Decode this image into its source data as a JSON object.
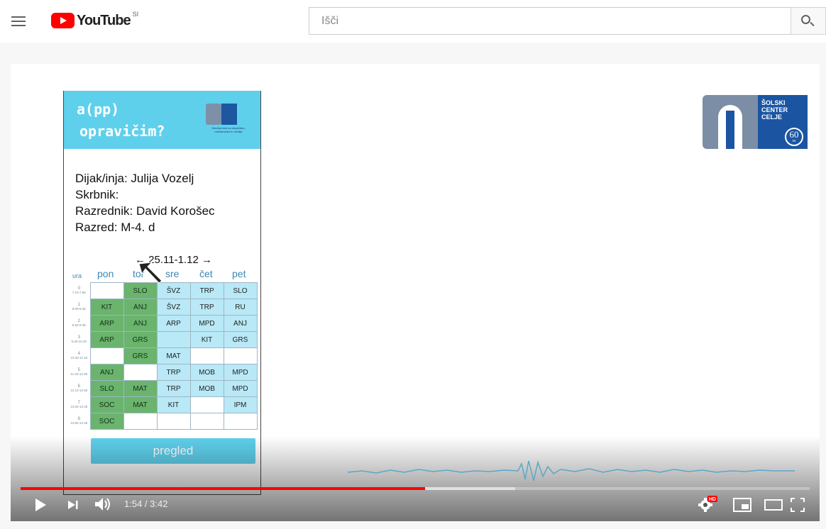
{
  "header": {
    "logo_text": "YouTube",
    "country_code": "SI",
    "search_placeholder": "Išči"
  },
  "video": {
    "app_title_line1": "a(pp)",
    "app_title_line2": "opravičim?",
    "mini_logo_caption": "Srednja šola za strojništvo, mehatroniko in medije",
    "student_label": "Dijak/inja: Julija Vozelj",
    "guardian_label": "Skrbnik:",
    "teacher_label": "Razrednik: David Korošec",
    "class_label": "Razred: M-4. d",
    "week_nav": "← 25.11-1.12 →",
    "days": [
      "ura",
      "pon",
      "tor",
      "sre",
      "čet",
      "pet"
    ],
    "timetable": [
      {
        "num": "0",
        "time": "7.10-7.55",
        "cells": [
          [
            "",
            "w"
          ],
          [
            "SLO",
            "g"
          ],
          [
            "ŠVZ",
            "b"
          ],
          [
            "TRP",
            "b"
          ],
          [
            "SLO",
            "b"
          ]
        ]
      },
      {
        "num": "1",
        "time": "8.00-8.45",
        "cells": [
          [
            "KIT",
            "g"
          ],
          [
            "ANJ",
            "g"
          ],
          [
            "ŠVZ",
            "b"
          ],
          [
            "TRP",
            "b"
          ],
          [
            "RU",
            "b"
          ]
        ]
      },
      {
        "num": "2",
        "time": "8.50-9.35",
        "cells": [
          [
            "ARP",
            "g"
          ],
          [
            "ANJ",
            "g"
          ],
          [
            "ARP",
            "b"
          ],
          [
            "MPD",
            "b"
          ],
          [
            "ANJ",
            "b"
          ]
        ]
      },
      {
        "num": "3",
        "time": "9.40-10.25",
        "cells": [
          [
            "ARP",
            "g"
          ],
          [
            "GRS",
            "g"
          ],
          [
            "",
            "b"
          ],
          [
            "KIT",
            "b"
          ],
          [
            "GRS",
            "b"
          ]
        ]
      },
      {
        "num": "4",
        "time": "10.30-11.15",
        "cells": [
          [
            "",
            "w"
          ],
          [
            "GRS",
            "g"
          ],
          [
            "MAT",
            "b"
          ],
          [
            "",
            "w"
          ],
          [
            "",
            "w"
          ]
        ]
      },
      {
        "num": "5",
        "time": "11.20-12.05",
        "cells": [
          [
            "ANJ",
            "g"
          ],
          [
            "",
            "w"
          ],
          [
            "TRP",
            "b"
          ],
          [
            "MOB",
            "b"
          ],
          [
            "MPD",
            "b"
          ]
        ]
      },
      {
        "num": "6",
        "time": "12.10-12.55",
        "cells": [
          [
            "SLO",
            "g"
          ],
          [
            "MAT",
            "g"
          ],
          [
            "TRP",
            "b"
          ],
          [
            "MOB",
            "b"
          ],
          [
            "MPD",
            "b"
          ]
        ]
      },
      {
        "num": "7",
        "time": "13.00-13.45",
        "cells": [
          [
            "SOC",
            "g"
          ],
          [
            "MAT",
            "g"
          ],
          [
            "KIT",
            "b"
          ],
          [
            "",
            "w"
          ],
          [
            "IPM",
            "b"
          ]
        ]
      },
      {
        "num": "8",
        "time": "13.50-14.35",
        "cells": [
          [
            "SOC",
            "g"
          ],
          [
            "",
            "w"
          ],
          [
            "",
            "w"
          ],
          [
            "",
            "w"
          ],
          [
            "",
            "w"
          ]
        ]
      }
    ],
    "button_label": "pregled",
    "school_logo_text": [
      "ŠOLSKI",
      "CENTER",
      "CELJE"
    ],
    "school_logo_years": "60",
    "school_logo_years_label": "let"
  },
  "player": {
    "current_time": "1:54",
    "duration": "3:42",
    "time_display": "1:54 / 3:42",
    "progress_fraction": 0.513,
    "buffered_fraction": 0.627,
    "hd_badge": "HD",
    "accent_color": "#ff0000"
  },
  "icons": {
    "menu": "menu-icon",
    "search": "search-icon",
    "play": "play-icon",
    "next": "next-icon",
    "volume": "volume-icon",
    "settings": "gear-icon",
    "miniplayer": "miniplayer-icon",
    "theater": "theater-icon",
    "fullscreen": "fullscreen-icon"
  }
}
